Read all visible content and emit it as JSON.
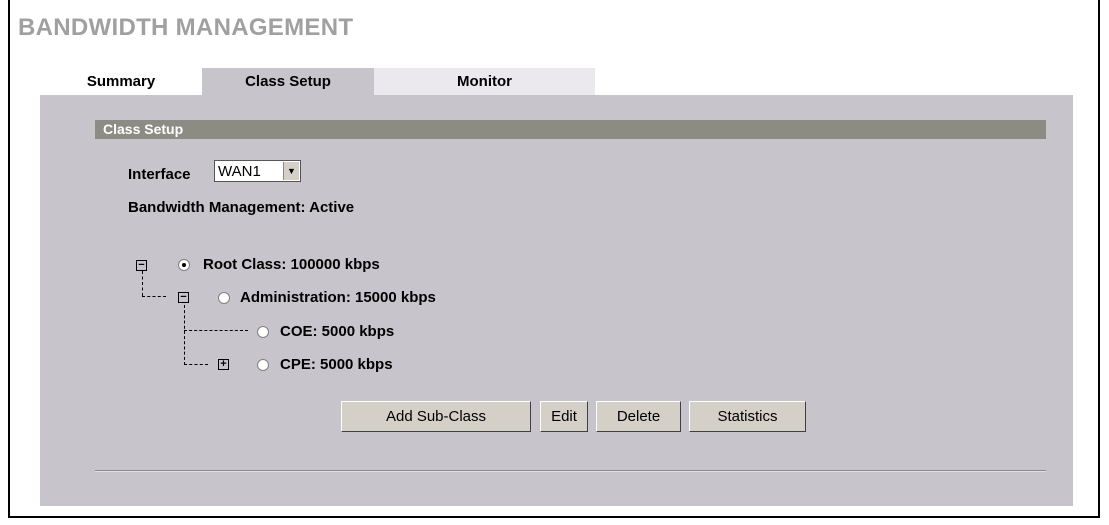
{
  "page": {
    "title": "BANDWIDTH MANAGEMENT"
  },
  "tabs": [
    {
      "label": "Summary"
    },
    {
      "label": "Class Setup"
    },
    {
      "label": "Monitor"
    }
  ],
  "section": {
    "title": "Class Setup"
  },
  "interface": {
    "label": "Interface",
    "value": "WAN1"
  },
  "status": {
    "text": "Bandwidth Management: Active"
  },
  "tree": [
    {
      "label": "Root Class: 100000 kbps",
      "toggle": "−",
      "selected": true
    },
    {
      "label": "Administration: 15000 kbps",
      "toggle": "−",
      "selected": false
    },
    {
      "label": "COE: 5000 kbps",
      "toggle": "",
      "selected": false
    },
    {
      "label": "CPE: 5000 kbps",
      "toggle": "+",
      "selected": false
    }
  ],
  "buttons": {
    "add_sub_class": "Add Sub-Class",
    "edit": "Edit",
    "delete": "Delete",
    "statistics": "Statistics"
  },
  "colors": {
    "panel": "#c8c4cc",
    "section_bar": "#8c8c84",
    "title_gray": "#a0a0a0"
  }
}
